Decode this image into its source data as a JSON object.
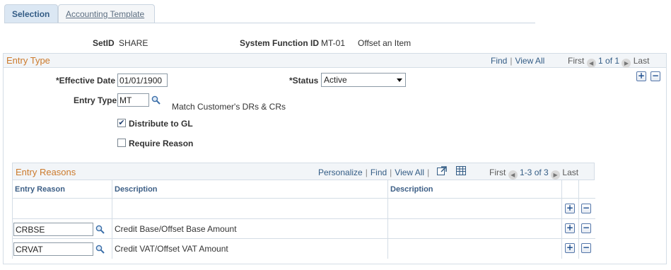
{
  "tabs": [
    {
      "label": "Selection"
    },
    {
      "label": "Accounting Template"
    }
  ],
  "header": {
    "setid_label": "SetID",
    "setid_value": "SHARE",
    "sysfunc_label": "System Function ID",
    "sysfunc_value": "MT-01",
    "sysfunc_desc": "Offset an Item"
  },
  "entry_type_section": {
    "title": "Entry Type",
    "nav": {
      "find": "Find",
      "view_all": "View All",
      "first": "First",
      "count": "1 of 1",
      "last": "Last"
    },
    "effective_date_label": "*Effective Date",
    "effective_date_value": "01/01/1900",
    "status_label": "*Status",
    "status_value": "Active",
    "entry_type_label": "Entry Type",
    "entry_type_value": "MT",
    "entry_type_desc": "Match Customer's DRs & CRs",
    "distribute_label": "Distribute to GL",
    "distribute_checked": true,
    "require_reason_label": "Require Reason",
    "require_reason_checked": false
  },
  "entry_reasons": {
    "title": "Entry Reasons",
    "nav": {
      "personalize": "Personalize",
      "find": "Find",
      "view_all": "View All",
      "first": "First",
      "count": "1-3 of 3",
      "last": "Last"
    },
    "columns": [
      "Entry Reason",
      "Description",
      "Description"
    ],
    "rows": [
      {
        "reason": "",
        "description": "",
        "description2": ""
      },
      {
        "reason": "CRBSE",
        "description": "Credit Base/Offset Base Amount",
        "description2": ""
      },
      {
        "reason": "CRVAT",
        "description": "Credit VAT/Offset VAT Amount",
        "description2": ""
      }
    ]
  },
  "icons": {
    "add": "+",
    "remove": "−",
    "prev": "◀",
    "next": "▶",
    "check": "✔"
  },
  "colors": {
    "section_title": "#cc7a2c",
    "link": "#335c85",
    "tab_active_bg": "#dbe7f3"
  }
}
